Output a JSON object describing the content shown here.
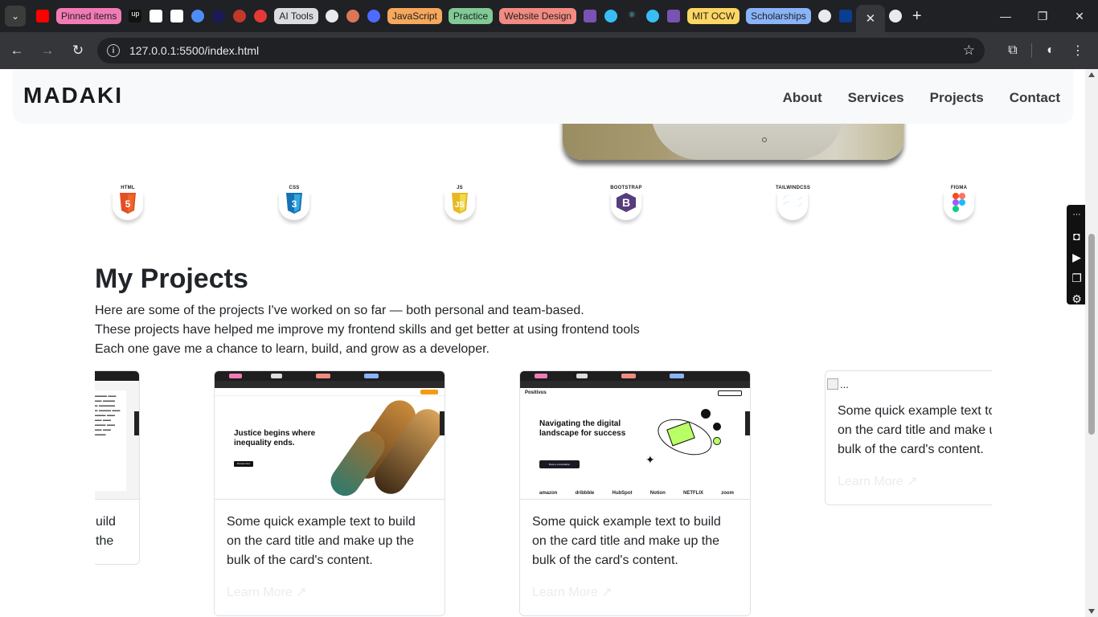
{
  "browser": {
    "tab_groups": [
      {
        "label": "Pinned items",
        "color": "#f27bb5"
      },
      {
        "label": "AI Tools",
        "color": "#dadce0"
      },
      {
        "label": "JavaScript",
        "color": "#f6a85c"
      },
      {
        "label": "Practice",
        "color": "#81c995"
      },
      {
        "label": "Website Design",
        "color": "#f28b82"
      },
      {
        "label": "MIT OCW",
        "color": "#fdd663"
      },
      {
        "label": "Scholarships",
        "color": "#8ab4f8"
      }
    ],
    "active_tab_close": "✕",
    "new_tab": "+",
    "url": "127.0.0.1:5500/index.html",
    "window": {
      "minimize": "—",
      "maximize": "❐",
      "close": "✕"
    }
  },
  "site": {
    "brand": "MADAKI",
    "nav": [
      "About",
      "Services",
      "Projects",
      "Contact"
    ]
  },
  "skills": [
    {
      "label": "HTML",
      "glyph": "5",
      "color": "#e34f26",
      "icon": "html5-icon"
    },
    {
      "label": "CSS",
      "glyph": "3",
      "color": "#1572b6",
      "icon": "css3-icon"
    },
    {
      "label": "JS",
      "glyph": "JS",
      "color": "#f0db4f",
      "icon": "js-icon"
    },
    {
      "label": "BOOTSTRAP",
      "glyph": "B",
      "color": "#563d7c",
      "icon": "bootstrap-icon"
    },
    {
      "label": "TAILWINDCSS",
      "glyph": "≈",
      "color": "#38bdf8",
      "icon": "tailwind-icon"
    },
    {
      "label": "FIGMA",
      "glyph": "◉",
      "color": "#a259ff",
      "icon": "figma-icon"
    }
  ],
  "projects": {
    "title": "My Projects",
    "description": [
      "Here are some of the projects I've worked on so far — both personal and team-based.",
      "These projects have helped me improve my frontend skills and get better at using frontend tools",
      "Each one gave me a chance to learn, build, and grow as a developer."
    ],
    "card_text": "Some quick example text to build on the card title and make up the bulk of the card's content.",
    "card_text_partial": "uild the",
    "card_link": "Learn More ↗",
    "card_img_alt": "...",
    "justice": {
      "headline": "Justice begins where inequality ends.",
      "btn": "Donate Now"
    },
    "positivus": {
      "brand": "Positivus",
      "headline": "Navigating the digital landscape for success",
      "btn": "Book a consultation",
      "logos": [
        "amazon",
        "dribbble",
        "HubSpot",
        "Notion",
        "NETFLIX",
        "zoom"
      ]
    }
  }
}
